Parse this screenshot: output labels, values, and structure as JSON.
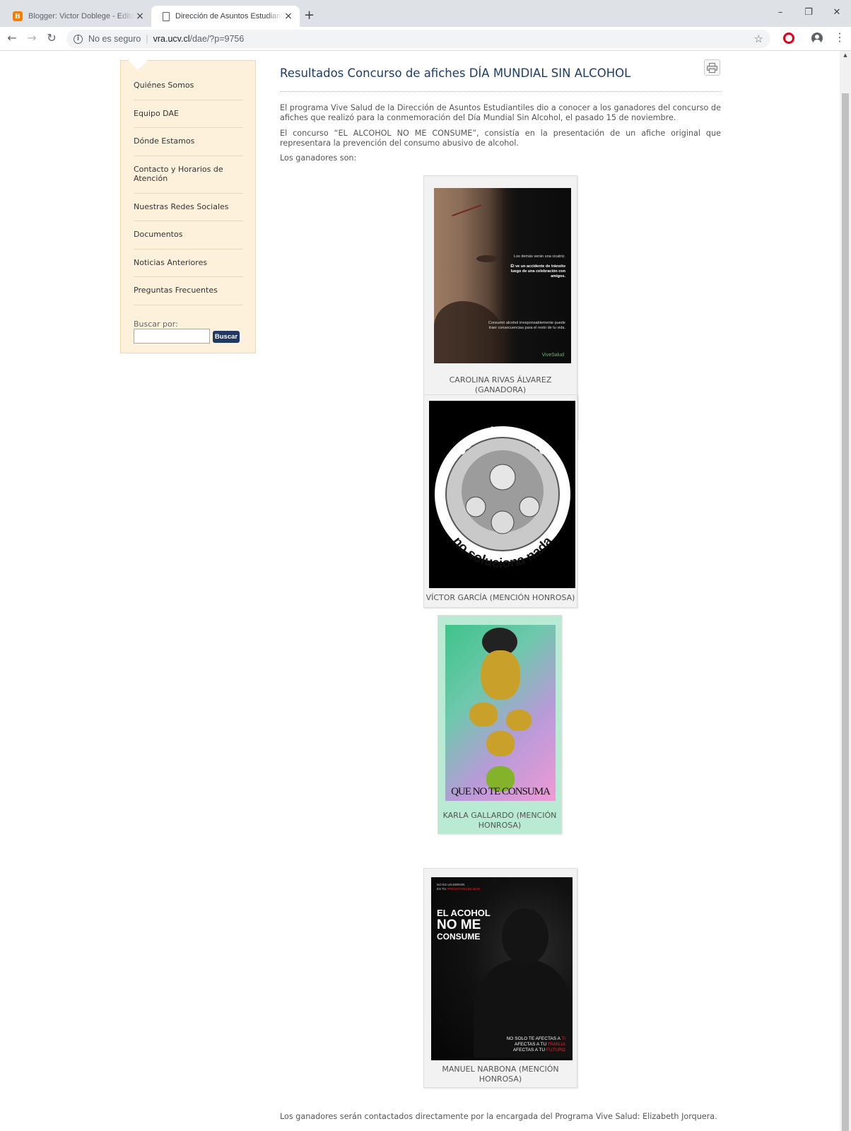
{
  "browser": {
    "tabs": [
      {
        "title": "Blogger: Victor Doblege - Editar e",
        "icon": "blogger-icon",
        "active": false
      },
      {
        "title": "Dirección de Asuntos Estudiantile",
        "icon": "page-icon",
        "active": true
      }
    ],
    "new_tab_label": "+",
    "window_controls": {
      "minimize": "–",
      "restore": "❐",
      "close": "✕"
    },
    "nav": {
      "back": "←",
      "forward": "→",
      "reload": "↻"
    },
    "address": {
      "security_label": "No es seguro",
      "separator": "|",
      "host": "vra.ucv.cl",
      "path": "/dae/?p=9756"
    },
    "bookmark_icon": "☆",
    "menu_icon": "⋮"
  },
  "sidebar": {
    "items": [
      "Quiénes Somos",
      "Equipo DAE",
      "Dónde Estamos",
      "Contacto y Horarios de Atención",
      "Nuestras Redes Sociales",
      "Documentos",
      "Noticias Anteriores",
      "Preguntas Frecuentes"
    ],
    "search_label": "Buscar por:",
    "search_value": "",
    "search_button": "Buscar"
  },
  "article": {
    "title": "Resultados Concurso de afiches DÍA MUNDIAL SIN ALCOHOL",
    "paragraphs": [
      "El programa Vive Salud de la Dirección de Asuntos Estudiantiles dio a conocer a los ganadores del concurso de afiches que realizó para la conmemoración del Día Mundial Sin Alcohol, el pasado 15 de noviembre.",
      "El concurso “EL ALCOHOL NO ME CONSUME”, consistía en la presentación de un afiche original que representara la prevención del consumo abusivo de alcohol.",
      "Los ganadores son:"
    ],
    "figures": [
      {
        "caption": "CAROLINA RIVAS ÁLVAREZ (GANADORA)",
        "poster_text": {
          "line1": "Los demás verán una cicatriz.",
          "line2": "Él ve un accidente de tránsito luego de una celebración con amigos.",
          "line3": "Consumir alcohol irresponsablemente puede traer consecuencias para el resto de tu vida.",
          "logo": "ViveSalud"
        }
      },
      {
        "caption": "VÍCTOR GARCÍA (MENCIÓN HONROSA)",
        "poster_text": {
          "top": "estar borracho",
          "bottom": "no soluciona nada"
        }
      },
      {
        "caption": "KARLA GALLARDO (MENCIÓN HONROSA)",
        "poster_text": {
          "bottom": "QUE NO TE CONSUMA"
        }
      },
      {
        "caption": "MANUEL NARBONA (MENCIÓN HONROSA)",
        "poster_text": {
          "small1": "NO ES UN ERROR",
          "small2_prefix": "ES TU ",
          "small2_red": "IRRESPONSABILIDAD",
          "big1": "EL ACOHOL",
          "big2": "NO ME",
          "big3": "CONSUME",
          "b1_prefix": "NO SOLO TE AFECTAS A ",
          "b1_red": "TI",
          "b2_prefix": "AFECTAS A TU ",
          "b2_red": "FAMILIA",
          "b3_prefix": "AFECTAS A TU ",
          "b3_red": "FUTURO"
        }
      }
    ],
    "closing": "Los ganadores serán contactados directamente por la encargada del Programa Vive Salud: Elizabeth Jorquera."
  },
  "colors": {
    "title": "#1c3d6c",
    "sidebar_bg": "#fef1dc",
    "button": "#1f3864",
    "accent_red": "#e3262b"
  }
}
